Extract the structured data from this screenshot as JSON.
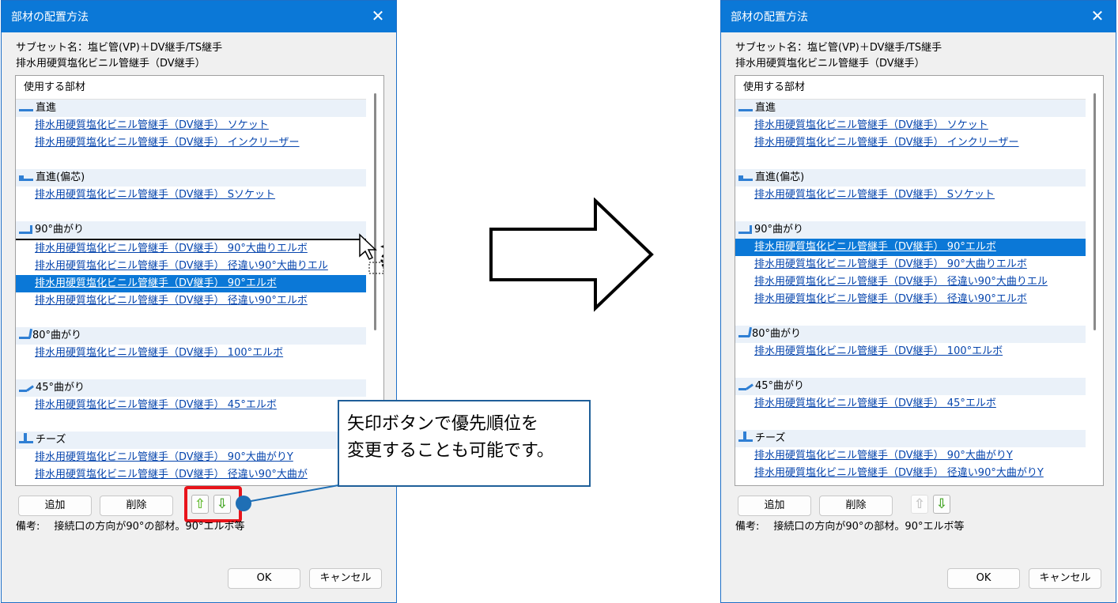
{
  "dialog_title": "部材の配置方法",
  "subset_line1": "サブセット名：塩ビ管(VP)＋DV継手/TS継手",
  "subset_line2": "排水用硬質塩化ビニル管継手（DV継手）",
  "list_header": "使用する部材",
  "categories": {
    "straight": "直進",
    "offset": "直進(偏芯)",
    "bend90": "90°曲がり",
    "bend80": "80°曲がり",
    "bend45": "45°曲がり",
    "tee": "チーズ"
  },
  "items": {
    "socket": "排水用硬質塩化ビニル管継手（DV継手） ソケット",
    "increaser": "排水用硬質塩化ビニル管継手（DV継手） インクリーザー",
    "s_socket": "排水用硬質塩化ビニル管継手（DV継手） Sソケット",
    "elbow90_large": "排水用硬質塩化ビニル管継手（DV継手） 90°大曲りエルボ",
    "elbow90_reducer_large": "排水用硬質塩化ビニル管継手（DV継手） 径違い90°大曲りエル",
    "elbow90": "排水用硬質塩化ビニル管継手（DV継手） 90°エルボ",
    "elbow90_reducer": "排水用硬質塩化ビニル管継手（DV継手） 径違い90°エルボ",
    "elbow100": "排水用硬質塩化ビニル管継手（DV継手） 100°エルボ",
    "elbow45": "排水用硬質塩化ビニル管継手（DV継手） 45°エルボ",
    "y90_large": "排水用硬質塩化ビニル管継手（DV継手） 90°大曲がりY",
    "y90_reducer_left": "排水用硬質塩化ビニル管継手（DV継手） 径違い90°大曲が",
    "y90_reducer_right": "排水用硬質塩化ビニル管継手（DV継手） 径違い90°大曲がりY"
  },
  "buttons": {
    "add": "追加",
    "delete": "削除",
    "ok": "OK",
    "cancel": "キャンセル",
    "up_icon": "⇧",
    "down_icon": "⇩"
  },
  "note_label": "備考:",
  "note_text": "接続口の方向が90°の部材。90°エルボ等",
  "callout_line1": "矢印ボタンで優先順位を",
  "callout_line2": "変更することも可能です。",
  "close_glyph": "✕",
  "colors": {
    "titlebar": "#0b78d7",
    "selection": "#0b78d7",
    "link": "#0645ad",
    "highlight_box": "#e8141b",
    "callout_border": "#1f5f99"
  }
}
